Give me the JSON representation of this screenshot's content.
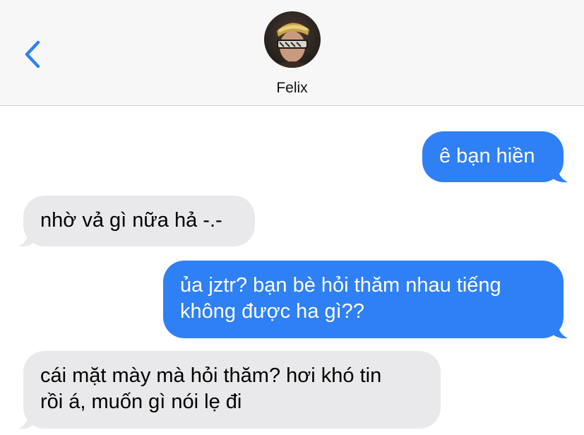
{
  "header": {
    "contact_name": "Felix"
  },
  "messages": [
    {
      "direction": "sent",
      "lines": [
        "ê bạn hiền"
      ]
    },
    {
      "direction": "received",
      "lines": [
        "nhờ vả gì nữa hả -.-"
      ]
    },
    {
      "direction": "sent",
      "lines": [
        "ủa jztr? bạn bè hỏi thăm nhau tiếng",
        "không được ha gì??"
      ]
    },
    {
      "direction": "received",
      "lines": [
        "cái mặt mày mà hỏi thăm? hơi khó tin",
        "rồi á, muốn gì nói lẹ đi"
      ]
    }
  ],
  "colors": {
    "sent_bubble": "#2f80f4",
    "received_bubble": "#e9e9eb",
    "accent": "#2f80f4",
    "header_bg": "#f7f7f7"
  }
}
